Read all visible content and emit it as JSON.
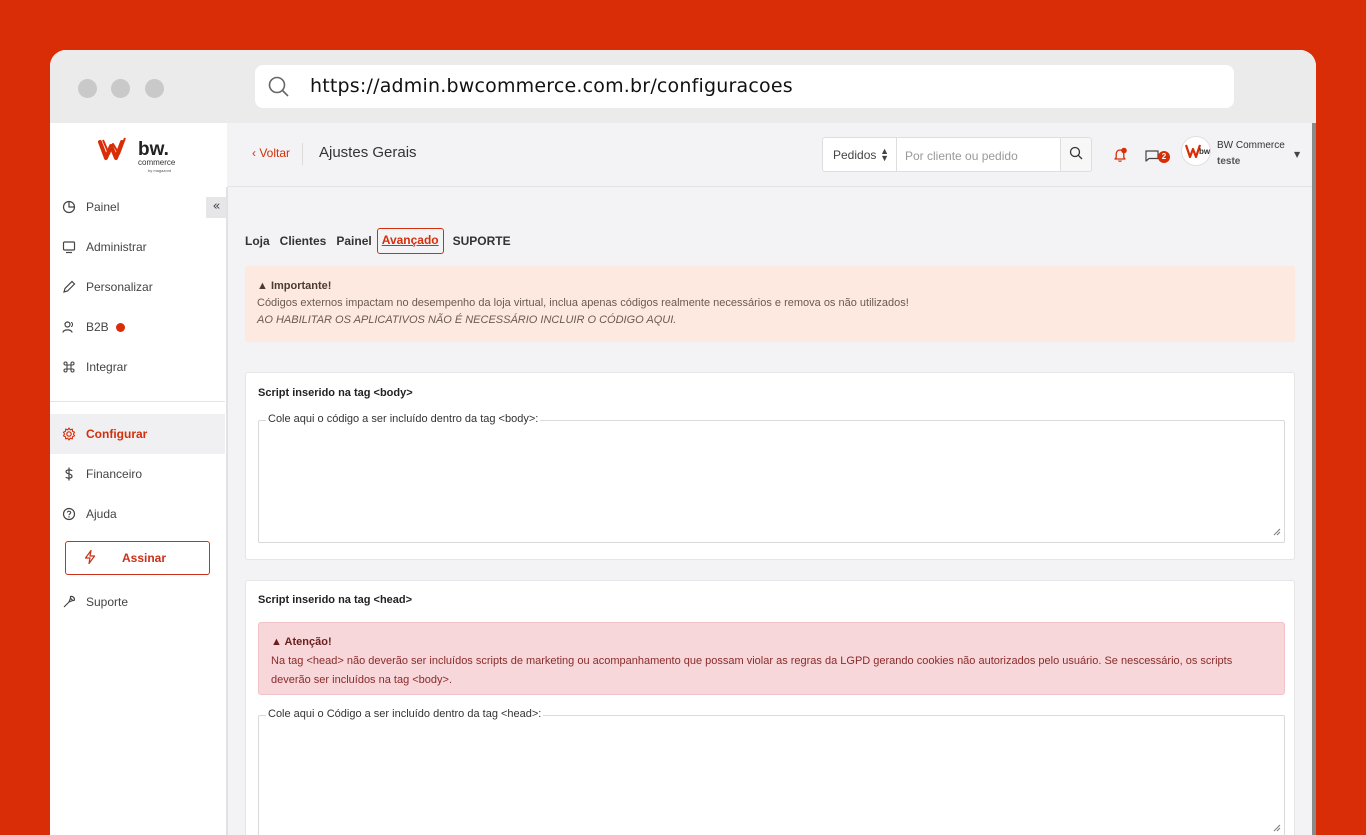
{
  "browser": {
    "url": "https://admin.bwcommerce.com.br/configuracoes"
  },
  "brand": {
    "logo_text": "bw.",
    "logo_sub": "commerce",
    "logo_by": "by magazord",
    "accent": "#d92d07"
  },
  "sidebar": {
    "items": [
      {
        "label": "Painel",
        "icon": "pie-chart-icon"
      },
      {
        "label": "Administrar",
        "icon": "monitor-icon"
      },
      {
        "label": "Personalizar",
        "icon": "pencil-icon"
      },
      {
        "label": "B2B",
        "icon": "users-icon"
      },
      {
        "label": "Integrar",
        "icon": "command-icon"
      },
      {
        "label": "Configurar",
        "icon": "gear-icon",
        "active": true
      },
      {
        "label": "Financeiro",
        "icon": "dollar-icon"
      },
      {
        "label": "Ajuda",
        "icon": "help-circle-icon"
      },
      {
        "label": "Suporte",
        "icon": "wrench-icon"
      }
    ],
    "assinar_label": "Assinar",
    "collapse_label": "«"
  },
  "topbar": {
    "back_label": "Voltar",
    "title": "Ajustes Gerais",
    "search_scope": "Pedidos",
    "search_placeholder": "Por cliente ou pedido",
    "chat_count": "2",
    "user_name": "BW Commerce",
    "user_role": "teste"
  },
  "tabs": [
    "Loja",
    "Clientes",
    "Painel",
    "Avançado",
    "SUPORTE"
  ],
  "important": {
    "title": "Importante!",
    "line1": "Códigos externos impactam no desempenho da loja virtual, inclua apenas códigos realmente necessários e remova os não utilizados!",
    "line2": "AO HABILITAR OS APLICATIVOS NÃO É NECESSÁRIO INCLUIR O CÓDIGO AQUI."
  },
  "body_card": {
    "title": "Script inserido na tag <body>",
    "legend": "Cole aqui o código a ser incluído dentro da tag <body>:"
  },
  "head_card": {
    "title": "Script inserido na tag <head>",
    "warn_title": "Atenção!",
    "warn_text": "Na tag <head> não deverão ser incluídos scripts de marketing ou acompanhamento que possam violar as regras da LGPD gerando cookies não autorizados pelo usuário. Se nescessário, os scripts deverão ser incluídos na tag <body>.",
    "legend": "Cole aqui o Código a ser incluído dentro da tag <head>:"
  }
}
